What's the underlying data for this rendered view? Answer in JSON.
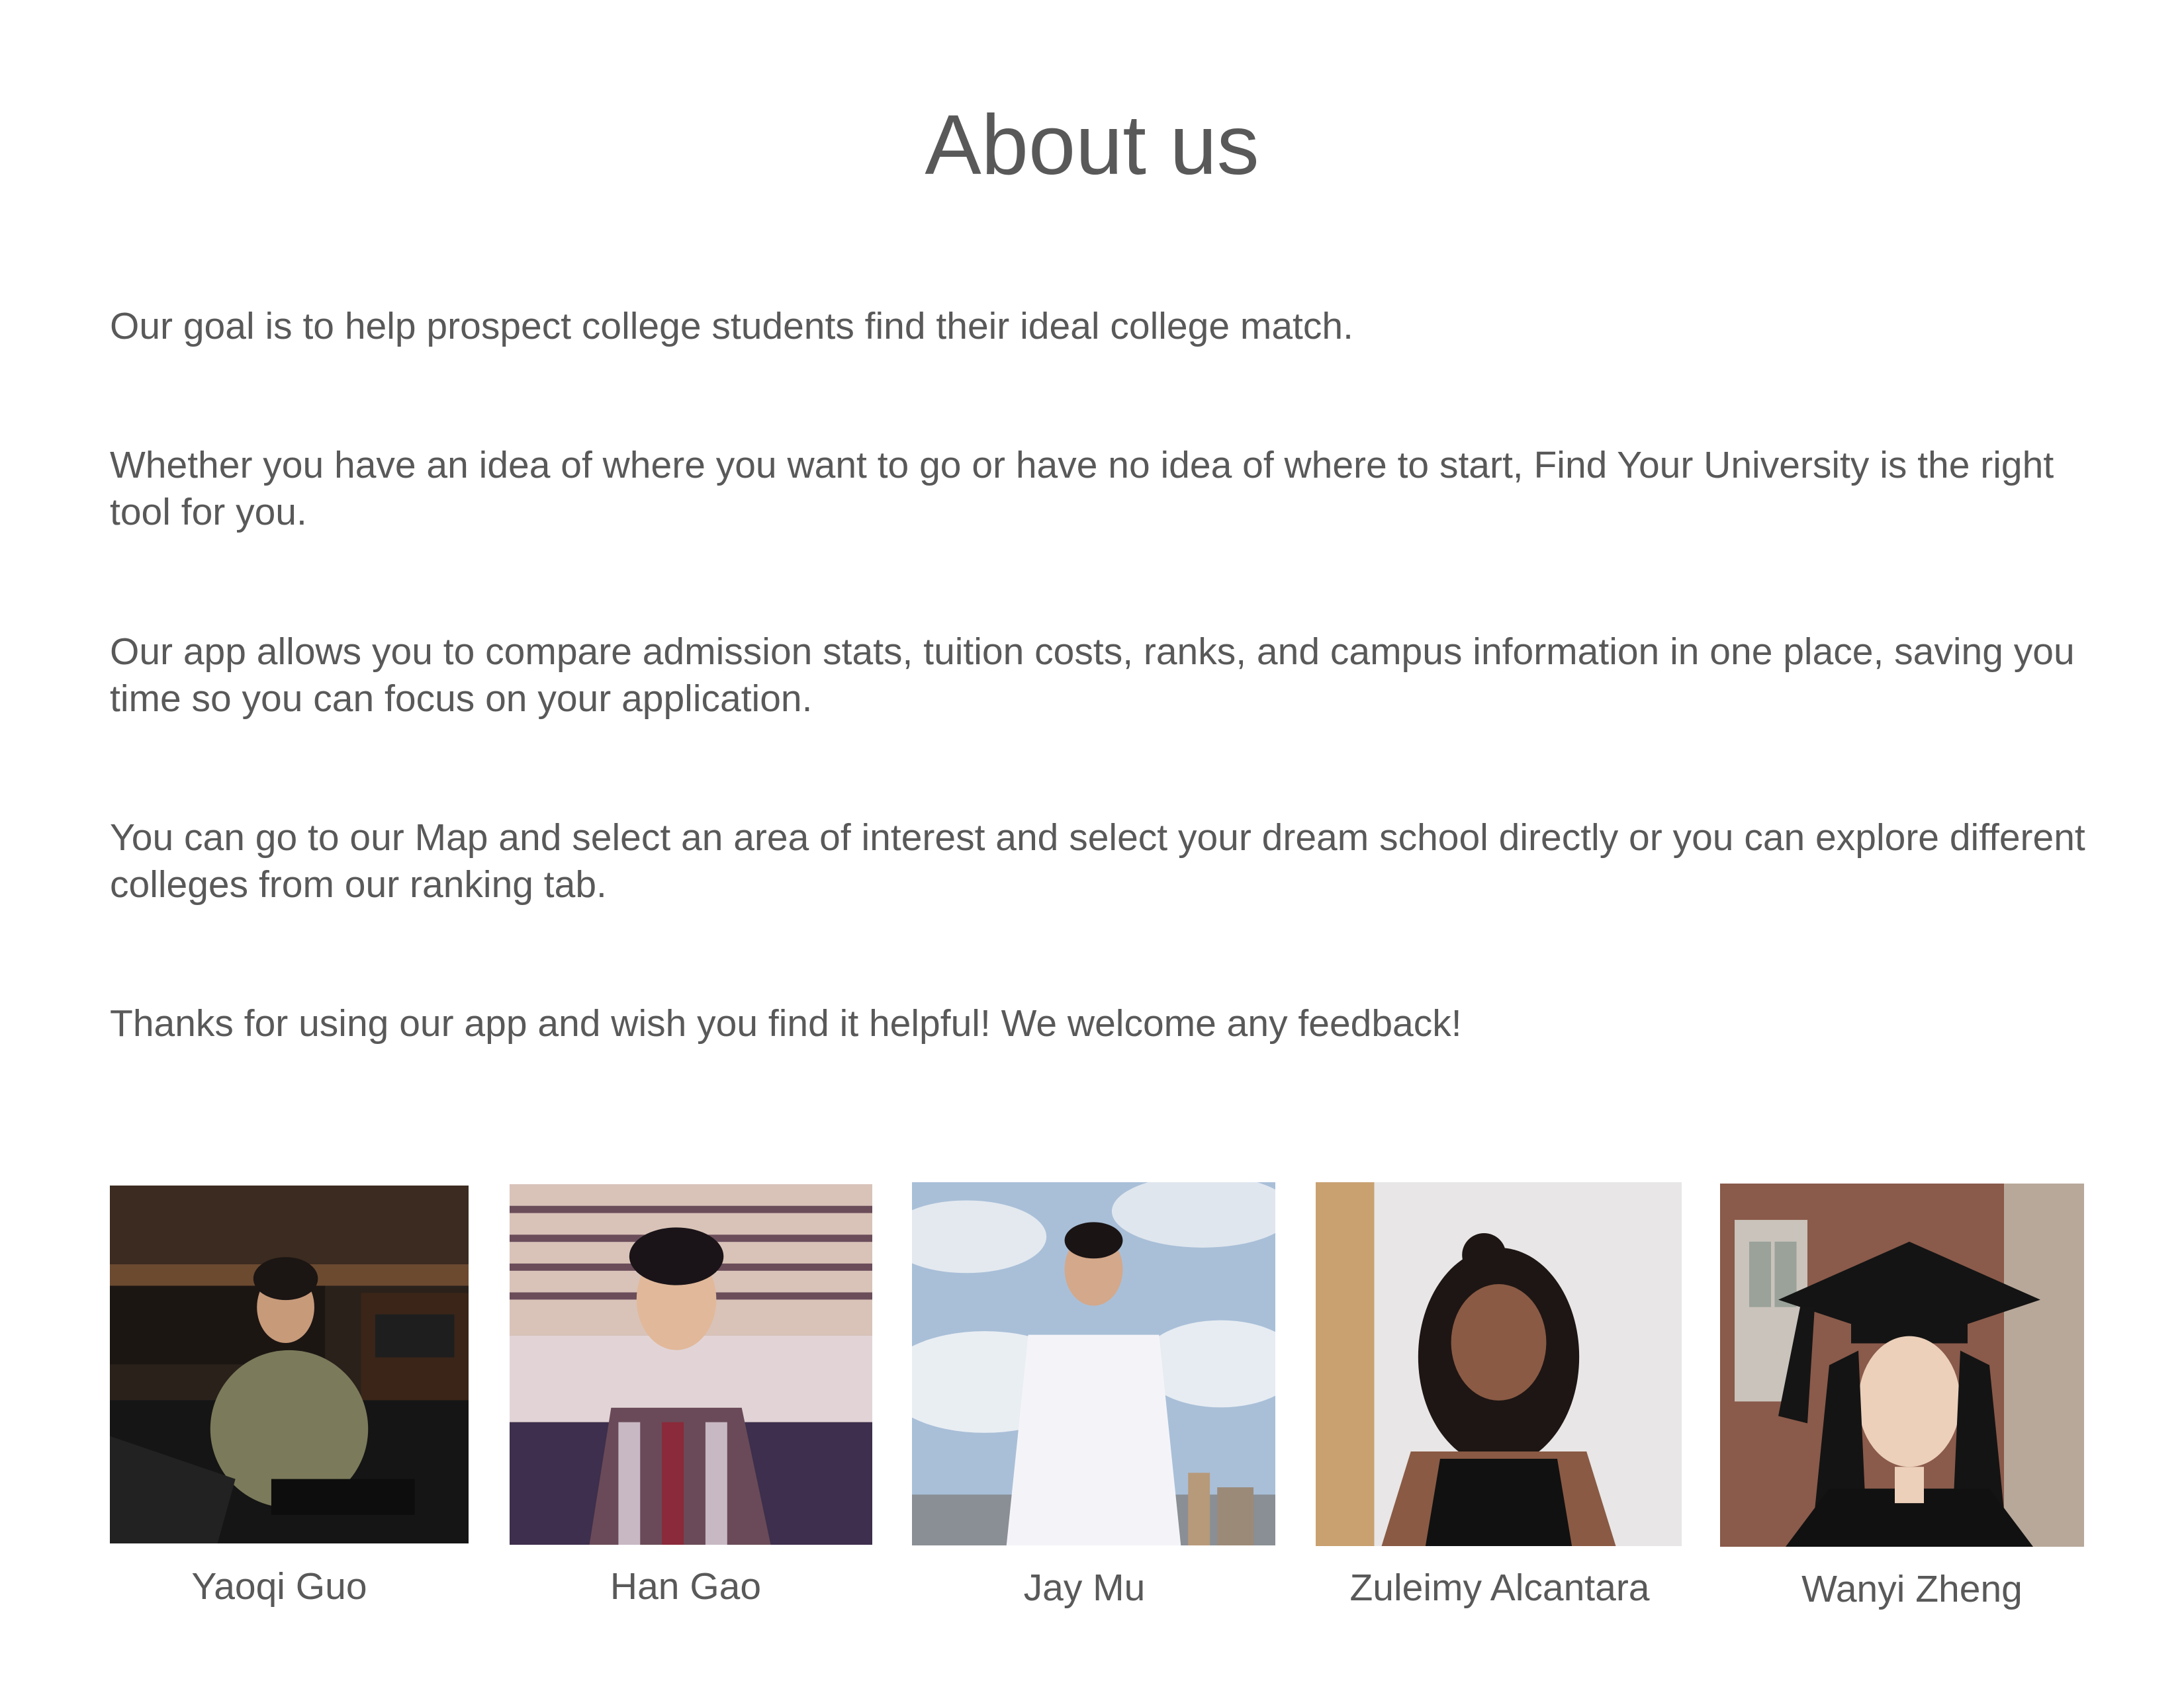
{
  "page": {
    "title": "About us"
  },
  "paragraphs": [
    "Our goal is to help prospect college students find their ideal college match.",
    "Whether you have an idea of where you want to go or have no idea of where to start, Find Your University is the right tool for you.",
    "Our app allows you to compare admission stats, tuition costs, ranks, and campus information in one place, saving you time so you can focus on your application.",
    "You can go to our Map and select an area of interest and select your dream school directly or you can explore different colleges from our ranking tab.",
    "Thanks for using our app and wish you find it helpful! We welcome any feedback!"
  ],
  "team": [
    {
      "name": "Yaoqi Guo",
      "photo_icon": "person-at-piano-photo"
    },
    {
      "name": "Han Gao",
      "photo_icon": "person-cruise-ship-photo"
    },
    {
      "name": "Jay Mu",
      "photo_icon": "person-sky-photo"
    },
    {
      "name": "Zuleimy Alcantara",
      "photo_icon": "person-portrait-photo"
    },
    {
      "name": "Wanyi Zheng",
      "photo_icon": "person-graduation-photo"
    }
  ],
  "colors": {
    "text": "#595959",
    "background": "#ffffff"
  }
}
